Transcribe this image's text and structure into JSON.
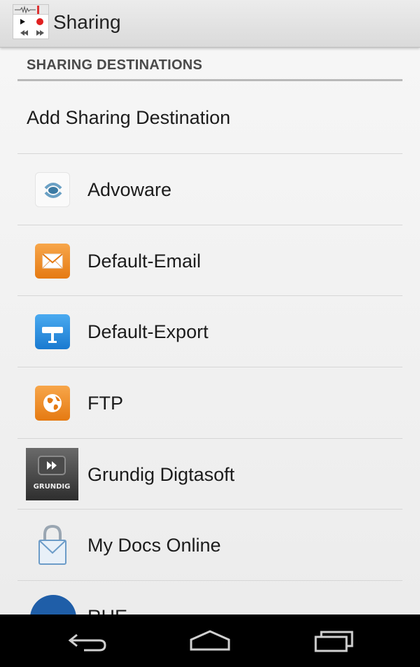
{
  "app_bar": {
    "title": "Sharing",
    "icon": "recorder-app-icon"
  },
  "section": {
    "header": "SHARING DESTINATIONS"
  },
  "add_destination": {
    "label": "Add Sharing Destination"
  },
  "destinations": [
    {
      "label": "Advoware",
      "icon": "advoware-logo-icon"
    },
    {
      "label": "Default-Email",
      "icon": "envelope-icon"
    },
    {
      "label": "Default-Export",
      "icon": "export-icon"
    },
    {
      "label": "FTP",
      "icon": "globe-icon"
    },
    {
      "label": "Grundig Digtasoft",
      "icon": "grundig-logo-icon"
    },
    {
      "label": "My Docs Online",
      "icon": "lock-envelope-icon"
    },
    {
      "label": "RHE",
      "icon": "rhe-logo-icon"
    }
  ],
  "nav": {
    "back": "back-icon",
    "home": "home-icon",
    "recents": "recents-icon"
  },
  "colors": {
    "email_orange": "#f08a24",
    "export_blue": "#2a8ee0",
    "ftp_orange": "#f08a24",
    "grundig_dark": "#3a3a3a"
  }
}
